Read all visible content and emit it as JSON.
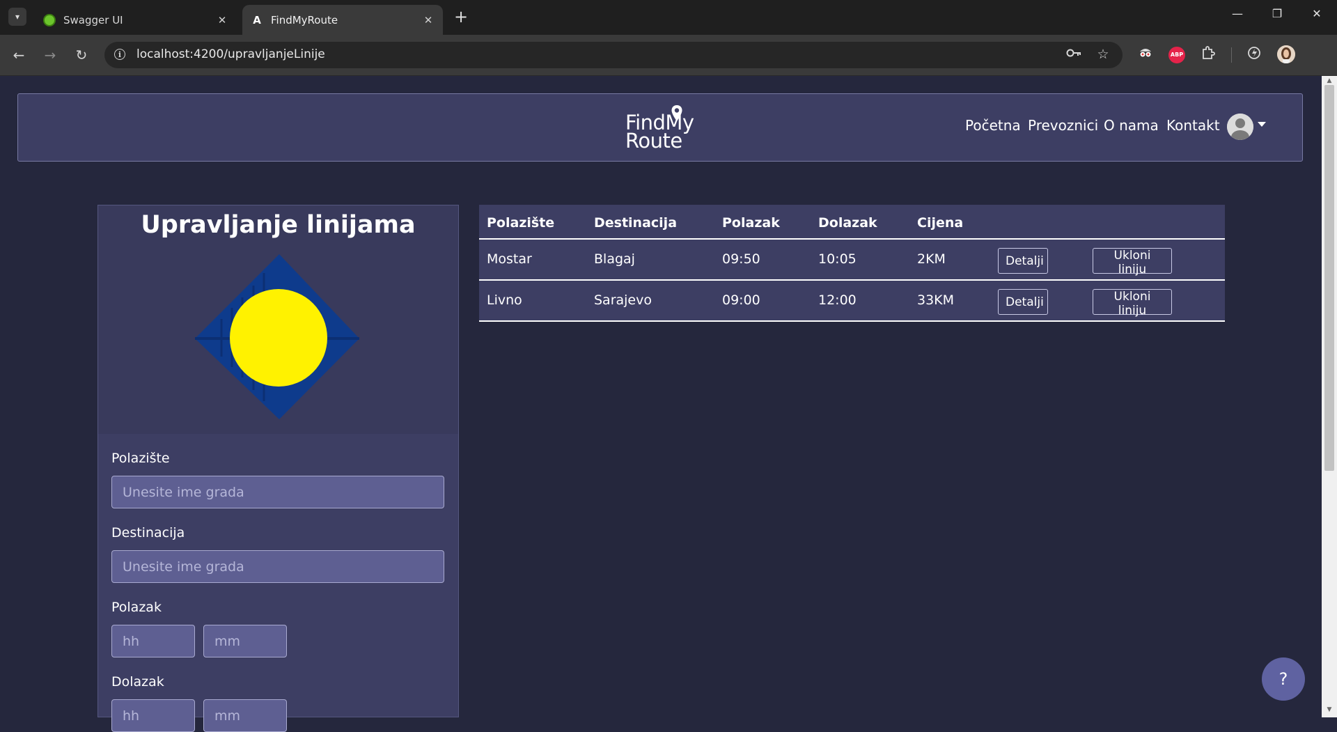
{
  "browser": {
    "tabs": [
      {
        "title": "Swagger UI",
        "icon": "swagger-icon",
        "active": false
      },
      {
        "title": "FindMyRoute",
        "icon": "angular-icon",
        "active": true
      }
    ],
    "new_tab_glyph": "+",
    "url": "localhost:4200/upravljanjeLinije",
    "window_controls": {
      "minimize": "—",
      "restore": "❐",
      "close": "✕"
    }
  },
  "navbar": {
    "logo_line1": "FindMy",
    "logo_line2": "Route",
    "links": [
      "Početna",
      "Prevoznici",
      "O nama",
      "Kontakt"
    ]
  },
  "form": {
    "title": "Upravljanje linijama",
    "fields": {
      "polaziste": {
        "label": "Polazište",
        "placeholder": "Unesite ime grada"
      },
      "destinacija": {
        "label": "Destinacija",
        "placeholder": "Unesite ime grada"
      },
      "polazak": {
        "label": "Polazak",
        "hh": "hh",
        "mm": "mm"
      },
      "dolazak": {
        "label": "Dolazak",
        "hh": "hh",
        "mm": "mm"
      }
    }
  },
  "table": {
    "headers": [
      "Polazište",
      "Destinacija",
      "Polazak",
      "Dolazak",
      "Cijena"
    ],
    "rows": [
      {
        "polaziste": "Mostar",
        "destinacija": "Blagaj",
        "polazak": "09:50",
        "dolazak": "10:05",
        "cijena": "2KM",
        "details": "Detalji",
        "remove": "Ukloni liniju"
      },
      {
        "polaziste": "Livno",
        "destinacija": "Sarajevo",
        "polazak": "09:00",
        "dolazak": "12:00",
        "cijena": "33KM",
        "details": "Detalji",
        "remove": "Ukloni liniju"
      }
    ]
  },
  "help_button": "?",
  "colors": {
    "page_bg": "#25273d",
    "panel_bg": "#3d3e63",
    "input_bg": "#5e5f92",
    "sun": "#fff200",
    "diamond": "#0e3b8c"
  }
}
